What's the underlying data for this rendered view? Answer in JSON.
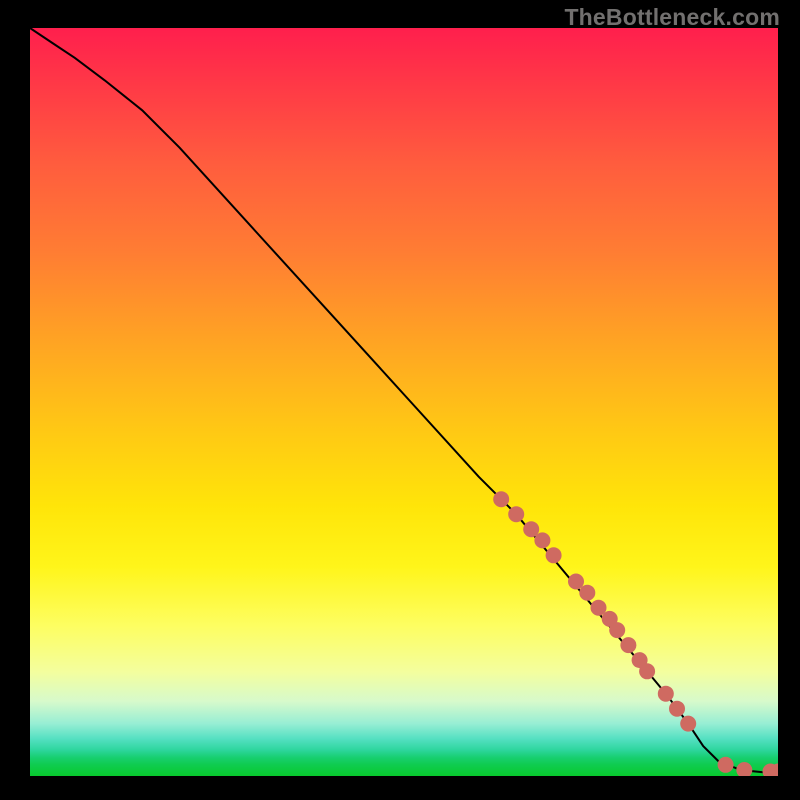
{
  "watermark": "TheBottleneck.com",
  "colors": {
    "background": "#000000",
    "dot": "#cf6a61",
    "line": "#000000"
  },
  "chart_data": {
    "type": "line",
    "title": "",
    "xlabel": "",
    "ylabel": "",
    "xlim": [
      0,
      100
    ],
    "ylim": [
      0,
      100
    ],
    "series": [
      {
        "name": "bottleneck-curve",
        "kind": "line",
        "x": [
          0,
          3,
          6,
          10,
          15,
          20,
          30,
          40,
          50,
          60,
          65,
          70,
          75,
          80,
          85,
          88,
          90,
          92,
          95,
          98,
          100
        ],
        "y": [
          100,
          98,
          96,
          93,
          89,
          84,
          73,
          62,
          51,
          40,
          35,
          29,
          23,
          17,
          11,
          7,
          4,
          2,
          0.8,
          0.5,
          0.5
        ]
      },
      {
        "name": "highlighted-points",
        "kind": "scatter",
        "x": [
          63,
          65,
          67,
          68.5,
          70,
          73,
          74.5,
          76,
          77.5,
          78.5,
          80,
          81.5,
          82.5,
          85,
          86.5,
          88,
          93,
          95.5,
          99,
          100
        ],
        "y": [
          37,
          35,
          33,
          31.5,
          29.5,
          26,
          24.5,
          22.5,
          21,
          19.5,
          17.5,
          15.5,
          14,
          11,
          9,
          7,
          1.5,
          0.8,
          0.6,
          0.6
        ]
      }
    ]
  }
}
